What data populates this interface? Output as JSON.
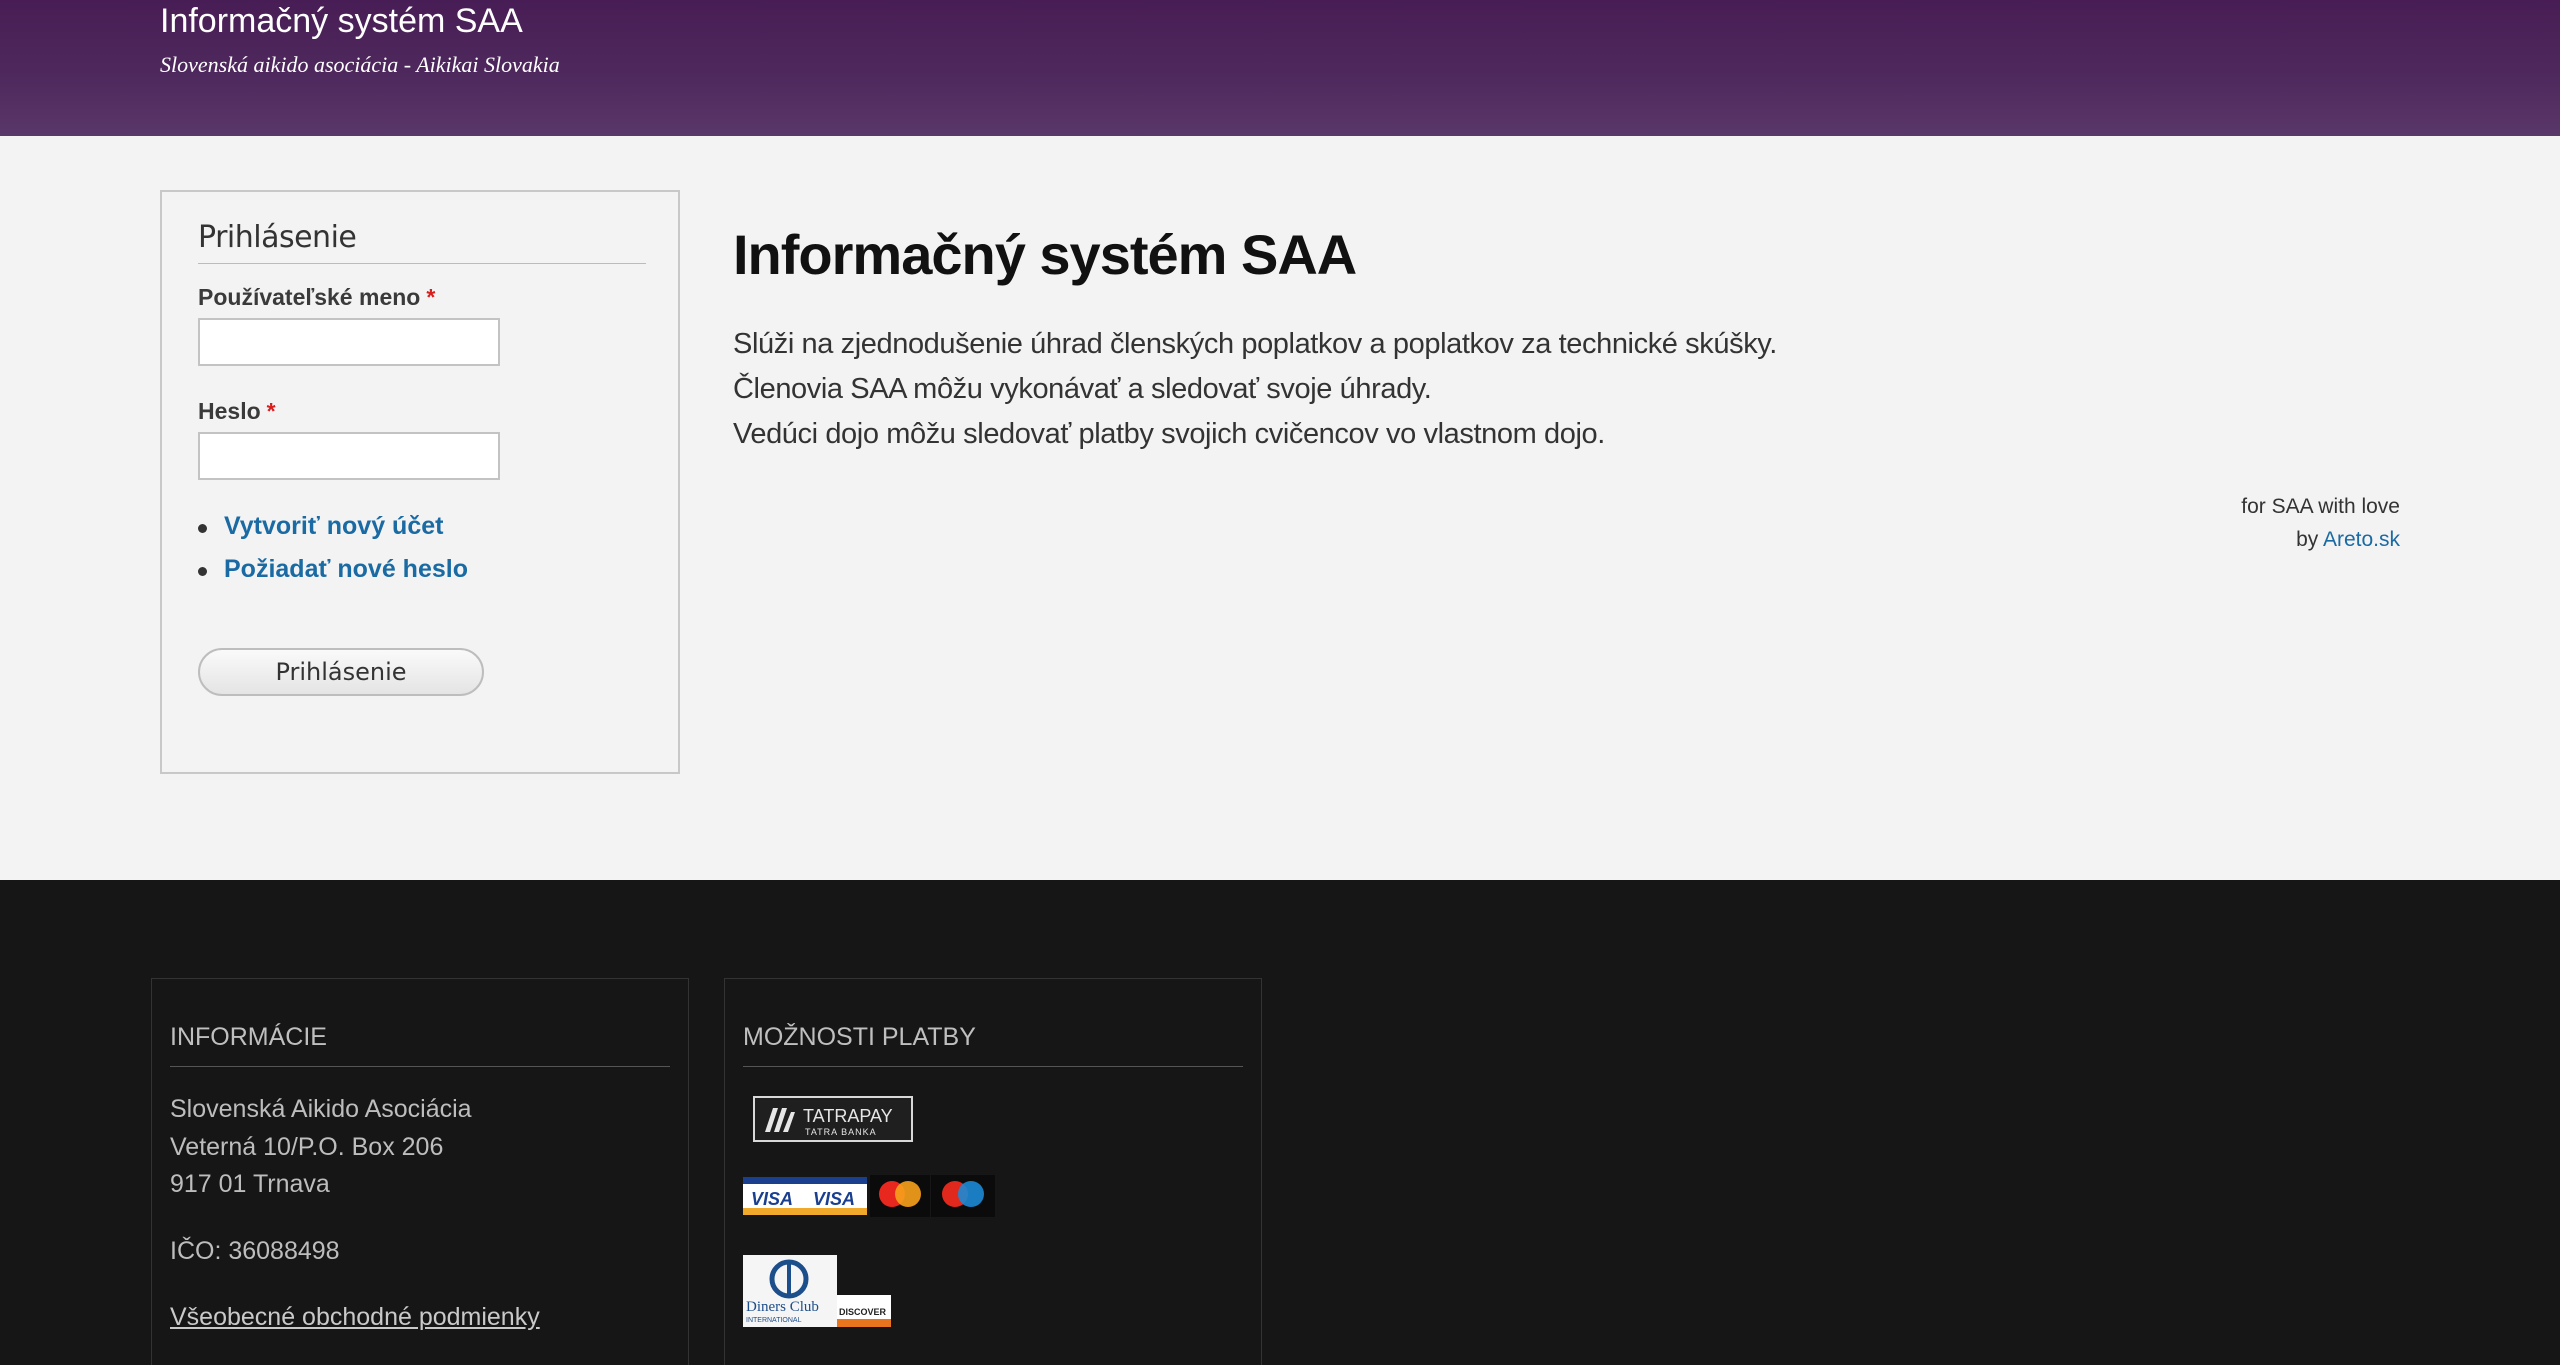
{
  "header": {
    "site_name": "Informačný systém SAA",
    "slogan": "Slovenská aikido asociácia - Aikikai Slovakia"
  },
  "login": {
    "title": "Prihlásenie",
    "username_label": "Používateľské meno",
    "password_label": "Heslo",
    "required_mark": "*",
    "username_value": "",
    "password_value": "",
    "links": [
      {
        "label": "Vytvoriť nový účet"
      },
      {
        "label": "Požiadať nové heslo"
      }
    ],
    "submit_label": "Prihlásenie"
  },
  "main": {
    "title": "Informačný systém SAA",
    "paragraphs": [
      "Slúži na zjednodušenie úhrad členských poplatkov a poplatkov za technické skúšky.",
      "Členovia SAA môžu vykonávať a sledovať svoje úhrady.",
      "Vedúci dojo môžu sledovať platby svojich cvičencov vo vlastnom dojo."
    ],
    "credit_line1": "for SAA with love",
    "credit_by": "by",
    "credit_link": "Areto.sk"
  },
  "footer": {
    "info": {
      "title": "INFORMÁCIE",
      "lines": [
        "Slovenská Aikido Asociácia",
        "Veterná 10/P.O. Box 206",
        "917 01 Trnava"
      ],
      "ico": "IČO: 36088498",
      "terms_link": "Všeobecné obchodné podmienky"
    },
    "payments": {
      "title": "MOŽNOSTI PLATBY",
      "logos": [
        {
          "name": "tatrapay-logo",
          "text": "TATRAPAY",
          "sub": "TATRA BANKA"
        },
        {
          "name": "visa-logo",
          "text": "VISA"
        },
        {
          "name": "visa-electron-logo",
          "text": "VISA"
        },
        {
          "name": "mastercard-logo",
          "text": ""
        },
        {
          "name": "maestro-logo",
          "text": ""
        },
        {
          "name": "diners-club-logo",
          "text": "Diners Club",
          "sub": "INTERNATIONAL"
        },
        {
          "name": "discover-logo",
          "text": "DISCOVER"
        }
      ]
    }
  }
}
